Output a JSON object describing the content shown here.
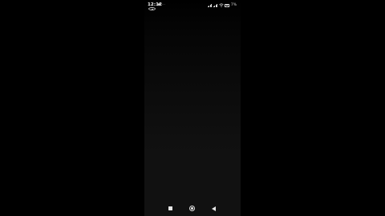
{
  "status_bar": {
    "time": "12:12",
    "notification_icon": "dot-icon",
    "notification_more": "···",
    "sub_icon": "eye-icon",
    "battery_percent": "7%",
    "battery_level": 0.7,
    "signal_icons": [
      "signal-icon",
      "signal-icon",
      "wifi-icon",
      "battery-icon"
    ]
  },
  "screen": {
    "content_state": "blank",
    "background_color": "#000000"
  },
  "nav_bar": {
    "recents_icon": "square-icon",
    "home_icon": "circle-icon",
    "back_icon": "triangle-back-icon",
    "icon_color": "#e6e6e6"
  }
}
